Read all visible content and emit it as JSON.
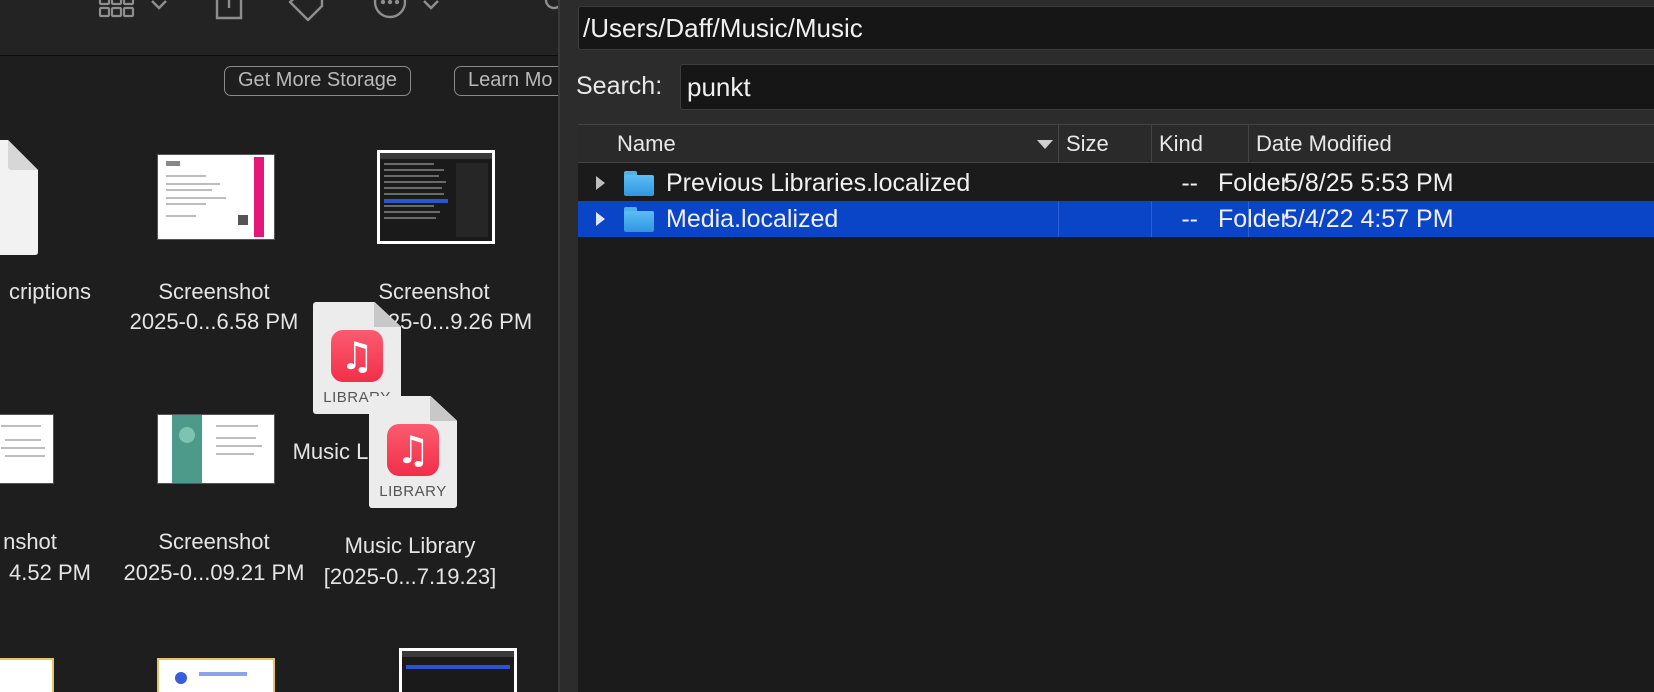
{
  "finder": {
    "toolbar_icons": [
      "grid-view-icon",
      "chevron-down-icon",
      "share-icon",
      "tag-icon",
      "more-icon",
      "chevron-down-icon"
    ],
    "storage_buttons": [
      "Get More Storage",
      "Learn Mo"
    ],
    "items": [
      {
        "line1": "criptions",
        "line2": ""
      },
      {
        "line1": "Screenshot",
        "line2": "2025-0...6.58 PM"
      },
      {
        "line1": "Screenshot",
        "line2": "25-0...9.26 PM"
      },
      {
        "line1": "nshot",
        "line2": "4.52 PM"
      },
      {
        "line1": "Screenshot",
        "line2": "2025-0...09.21 PM"
      },
      {
        "line1": "Music Library",
        "line2": "[2025-0...7.19.23]"
      }
    ],
    "dragging_label": "Music Library",
    "library_badge": "LIBRARY",
    "music_glyph": "♫"
  },
  "dialog": {
    "path": "/Users/Daff/Music/Music",
    "search_label": "Search:",
    "search_value": "punkt",
    "columns": [
      "Name",
      "Size",
      "Kind",
      "Date Modified"
    ],
    "rows": [
      {
        "name": "Previous Libraries.localized",
        "size": "--",
        "kind": "Folder",
        "date": "5/8/25 5:53 PM",
        "selected": false
      },
      {
        "name": "Media.localized",
        "size": "--",
        "kind": "Folder",
        "date": "5/4/22 4:57 PM",
        "selected": true
      }
    ],
    "colors": {
      "selection": "#0a45c8",
      "folder": "#3aa6ea"
    }
  }
}
